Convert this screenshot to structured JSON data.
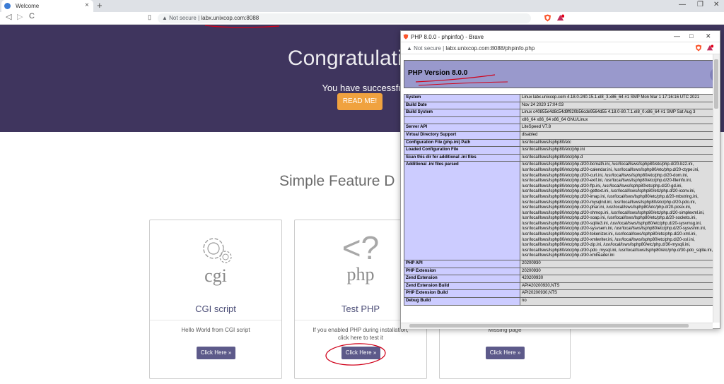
{
  "browser": {
    "tab_title": "Welcome",
    "tab_close": "×",
    "new_tab": "+",
    "back": "◁",
    "forward": "▷",
    "reload": "C",
    "bookmark": "▯",
    "not_secure_icon": "▲",
    "not_secure_label": "Not secure",
    "url": "labx.unixcop.com:8088",
    "min": "—",
    "restore": "❐",
    "close": "✕"
  },
  "page": {
    "hero_title": "Congratulations",
    "hero_subtitle": "You have successfully installed the OpenL",
    "readme_label": "READ ME!",
    "features_title": "Simple Feature D",
    "cards": [
      {
        "icon_text": "cgi",
        "title": "CGI script",
        "desc1": "Hello World from CGI script",
        "desc2": "",
        "button": "Click Here »"
      },
      {
        "icon_text": "php",
        "title": "Test PHP",
        "desc1": "If you enabled PHP during installation,",
        "desc2": "click here to test it",
        "button": "Click Here »"
      },
      {
        "icon_text": "",
        "title": "",
        "desc1": "Missing page",
        "desc2": "",
        "button": "Click Here »"
      }
    ]
  },
  "popup": {
    "title": "PHP 8.0.0 - phpinfo() - Brave",
    "not_secure_label": "Not secure",
    "url": "labx.unixcop.com:8088/phpinfo.php",
    "php_version": "PHP Version 8.0.0",
    "rows": [
      {
        "k": "System",
        "v": "Linux labx.unixcop.com 4.18.0-240.15.1.el8_3.x86_64 #1 SMP Mon Mar 1 17:16:16 UTC 2021"
      },
      {
        "k": "Build Date",
        "v": "Nov 24 2020 17:04:03"
      },
      {
        "k": "Build System",
        "v": "Linux c40855e4d8c54d9f920b56cde9564d55 4.18.0-80.7.1.el8_0.x86_64 #1 SMP Sat Aug 3"
      },
      {
        "k": "",
        "v": "x86_64 x86_64 x86_64 GNU/Linux"
      },
      {
        "k": "Server API",
        "v": "LiteSpeed V7.8"
      },
      {
        "k": "Virtual Directory Support",
        "v": "disabled"
      },
      {
        "k": "Configuration File (php.ini) Path",
        "v": "/usr/local/lsws/lsphp80/etc"
      },
      {
        "k": "Loaded Configuration File",
        "v": "/usr/local/lsws/lsphp80/etc/php.ini"
      },
      {
        "k": "Scan this dir for additional .ini files",
        "v": "/usr/local/lsws/lsphp80/etc/php.d"
      }
    ],
    "ini_key": "Additional .ini files parsed",
    "ini_lines": [
      "/usr/local/lsws/lsphp80/etc/php.d/20-bcmath.ini, /usr/local/lsws/lsphp80/etc/php.d/20-bz2.ini,",
      "/usr/local/lsws/lsphp80/etc/php.d/20-calendar.ini, /usr/local/lsws/lsphp80/etc/php.d/20-ctype.ini,",
      "/usr/local/lsws/lsphp80/etc/php.d/20-curl.ini, /usr/local/lsws/lsphp80/etc/php.d/20-dom.ini,",
      "/usr/local/lsws/lsphp80/etc/php.d/20-exif.ini, /usr/local/lsws/lsphp80/etc/php.d/20-fileinfo.ini,",
      "/usr/local/lsws/lsphp80/etc/php.d/20-ftp.ini, /usr/local/lsws/lsphp80/etc/php.d/20-gd.ini,",
      "/usr/local/lsws/lsphp80/etc/php.d/20-gettext.ini, /usr/local/lsws/lsphp80/etc/php.d/20-iconv.ini,",
      "/usr/local/lsws/lsphp80/etc/php.d/20-imap.ini, /usr/local/lsws/lsphp80/etc/php.d/20-mbstring.ini,",
      "/usr/local/lsws/lsphp80/etc/php.d/20-mysqlnd.ini, /usr/local/lsws/lsphp80/etc/php.d/20-pdo.ini,",
      "/usr/local/lsws/lsphp80/etc/php.d/20-phar.ini, /usr/local/lsws/lsphp80/etc/php.d/20-posix.ini,",
      "/usr/local/lsws/lsphp80/etc/php.d/20-shmop.ini, /usr/local/lsws/lsphp80/etc/php.d/20-simplexml.ini,",
      "/usr/local/lsws/lsphp80/etc/php.d/20-soap.ini, /usr/local/lsws/lsphp80/etc/php.d/20-sockets.ini,",
      "/usr/local/lsws/lsphp80/etc/php.d/20-sqlite3.ini, /usr/local/lsws/lsphp80/etc/php.d/20-sysvmsg.ini,",
      "/usr/local/lsws/lsphp80/etc/php.d/20-sysvsem.ini, /usr/local/lsws/lsphp80/etc/php.d/20-sysvshm.ini,",
      "/usr/local/lsws/lsphp80/etc/php.d/20-tokenizer.ini, /usr/local/lsws/lsphp80/etc/php.d/20-xml.ini,",
      "/usr/local/lsws/lsphp80/etc/php.d/20-xmlwriter.ini, /usr/local/lsws/lsphp80/etc/php.d/20-xsl.ini,",
      "/usr/local/lsws/lsphp80/etc/php.d/20-zip.ini, /usr/local/lsws/lsphp80/etc/php.d/30-mysqli.ini,",
      "/usr/local/lsws/lsphp80/etc/php.d/30-pdo_mysql.ini, /usr/local/lsws/lsphp80/etc/php.d/30-pdo_sqlite.ini,",
      "/usr/local/lsws/lsphp80/etc/php.d/30-xmlreader.ini"
    ],
    "rows2": [
      {
        "k": "PHP API",
        "v": "20200930"
      },
      {
        "k": "PHP Extension",
        "v": "20200930"
      },
      {
        "k": "Zend Extension",
        "v": "420200930"
      },
      {
        "k": "Zend Extension Build",
        "v": "API420200930,NTS"
      },
      {
        "k": "PHP Extension Build",
        "v": "API20200930,NTS"
      },
      {
        "k": "Debug Build",
        "v": "no"
      }
    ]
  },
  "colors": {
    "hero_bg": "#3f355e",
    "readme_bg": "#f0a23f",
    "card_button": "#5d5a8a",
    "php_header": "#9999cc",
    "php_key": "#ccccff",
    "php_value": "#dddddd",
    "annotation": "#d0021b"
  }
}
